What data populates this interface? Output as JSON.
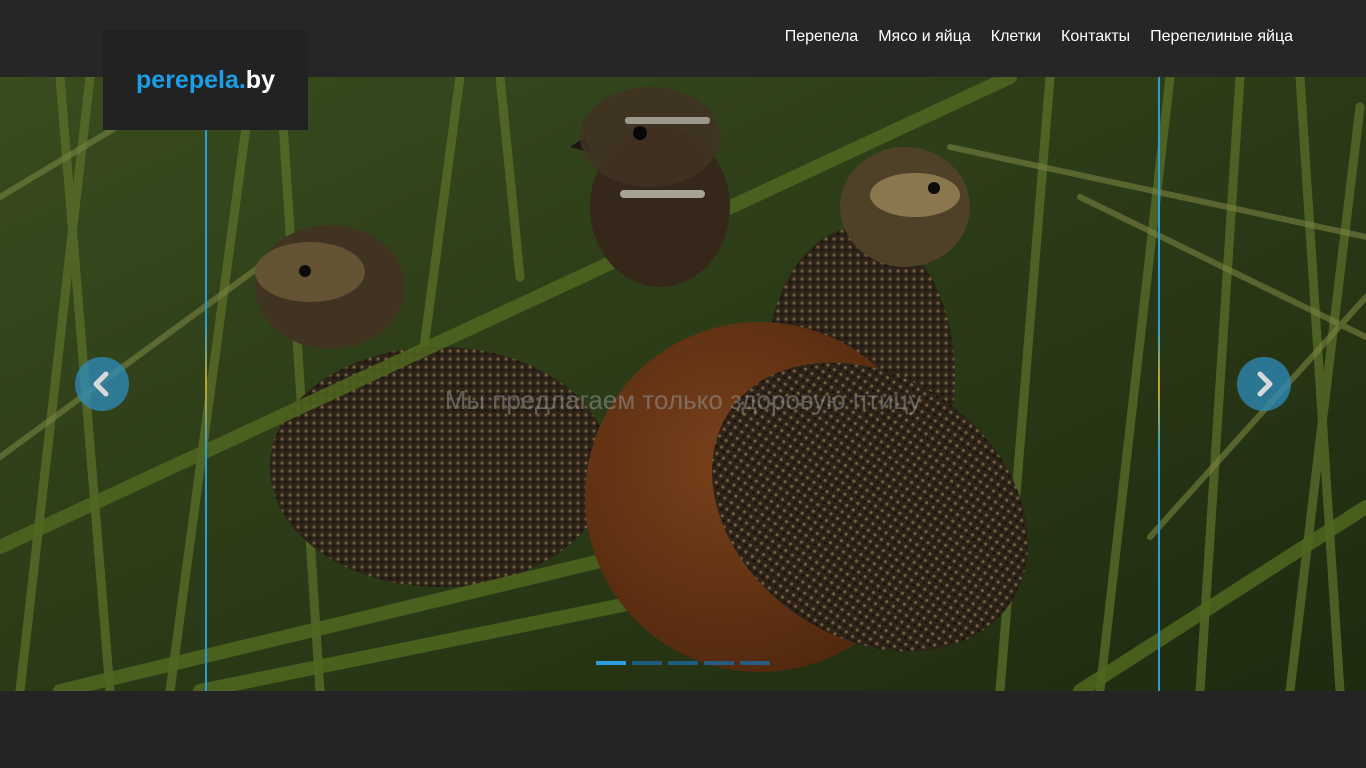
{
  "logo": {
    "main": "perepela.",
    "tld": "by"
  },
  "nav": {
    "items": [
      {
        "label": "Перепела"
      },
      {
        "label": "Мясо и яйца"
      },
      {
        "label": "Клетки"
      },
      {
        "label": "Контакты"
      },
      {
        "label": "Перепелиные яйца"
      }
    ]
  },
  "slider": {
    "caption": "Мы предлагаем только здоровую птицу",
    "prev_icon": "chevron-left-icon",
    "next_icon": "chevron-right-icon",
    "slide_count": 5,
    "active_slide": 1
  },
  "colors": {
    "brand": "#1b9ee8",
    "header_bg": "#262626",
    "accent_line": "#2a9fd6"
  }
}
